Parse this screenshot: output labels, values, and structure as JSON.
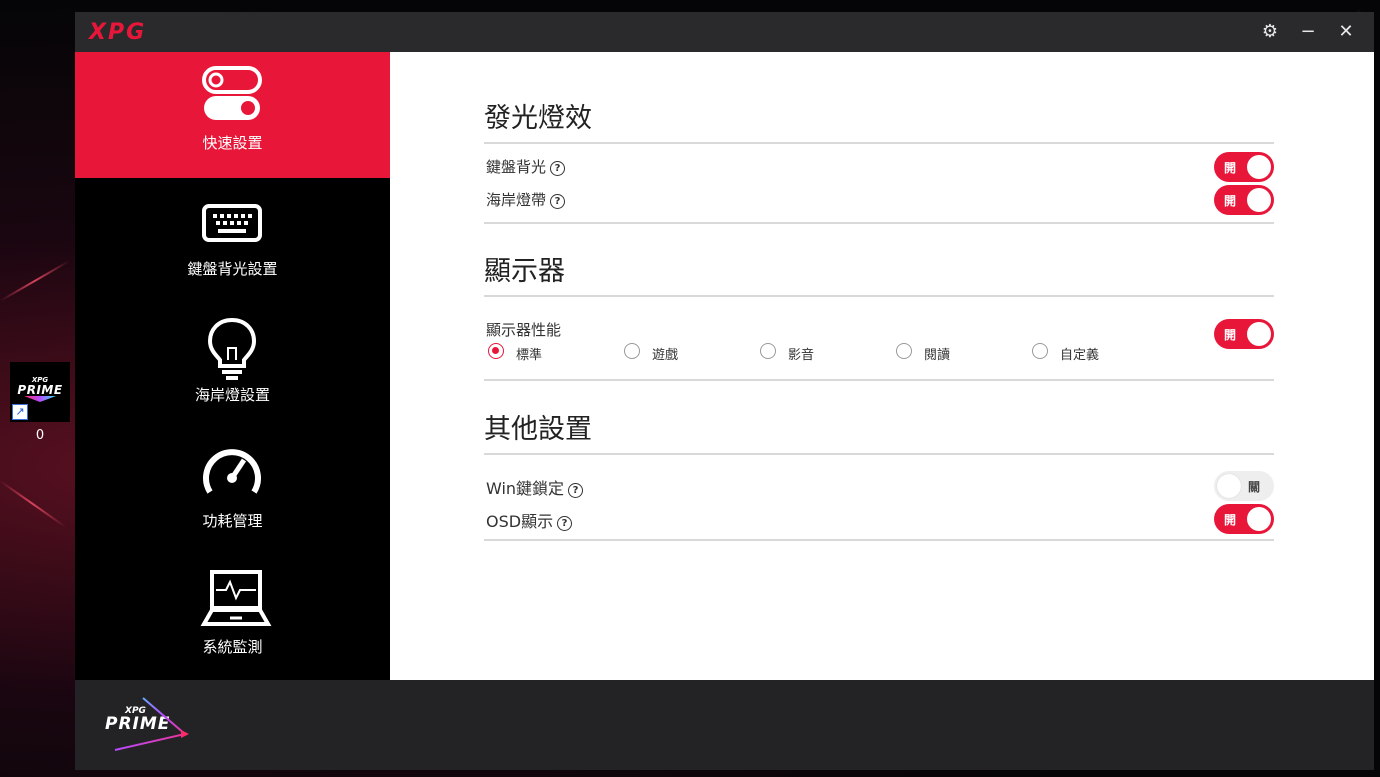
{
  "desktop": {
    "shortcut_logo_top": "XPG",
    "shortcut_logo_main": "PRIME",
    "shortcut_label": "0"
  },
  "app": {
    "brand": "XPG",
    "footer_logo_top": "XPG",
    "footer_logo_main": "PRIME"
  },
  "window_controls": {
    "settings": "⚙",
    "minimize": "−",
    "close": "✕"
  },
  "nav": [
    {
      "id": "quick",
      "label": "快速設置",
      "icon": "toggle-switches-icon",
      "active": true
    },
    {
      "id": "keyboard",
      "label": "鍵盤背光設置",
      "icon": "keyboard-icon",
      "active": false
    },
    {
      "id": "coast",
      "label": "海岸燈設置",
      "icon": "lightbulb-icon",
      "active": false
    },
    {
      "id": "power",
      "label": "功耗管理",
      "icon": "speedometer-icon",
      "active": false
    },
    {
      "id": "monitor",
      "label": "系統監測",
      "icon": "laptop-monitor-icon",
      "active": false
    }
  ],
  "sections": {
    "lighting": {
      "title": "發光燈效",
      "rows": [
        {
          "label": "鍵盤背光",
          "toggle": "開",
          "state": "on"
        },
        {
          "label": "海岸燈帶",
          "toggle": "開",
          "state": "on"
        }
      ]
    },
    "display": {
      "title": "顯示器",
      "row_label": "顯示器性能",
      "toggle": "開",
      "state": "on",
      "modes": [
        "標準",
        "遊戲",
        "影音",
        "閱讀",
        "自定義"
      ],
      "selected_mode": "標準"
    },
    "other": {
      "title": "其他設置",
      "rows": [
        {
          "label": "Win鍵鎖定",
          "toggle": "關",
          "state": "off"
        },
        {
          "label": "OSD顯示",
          "toggle": "開",
          "state": "on"
        }
      ]
    }
  },
  "help_glyph": "?",
  "colors": {
    "accent": "#e8173a",
    "sidebar": "#000000",
    "titlebar": "#2a2a2c",
    "content": "#ffffff"
  }
}
